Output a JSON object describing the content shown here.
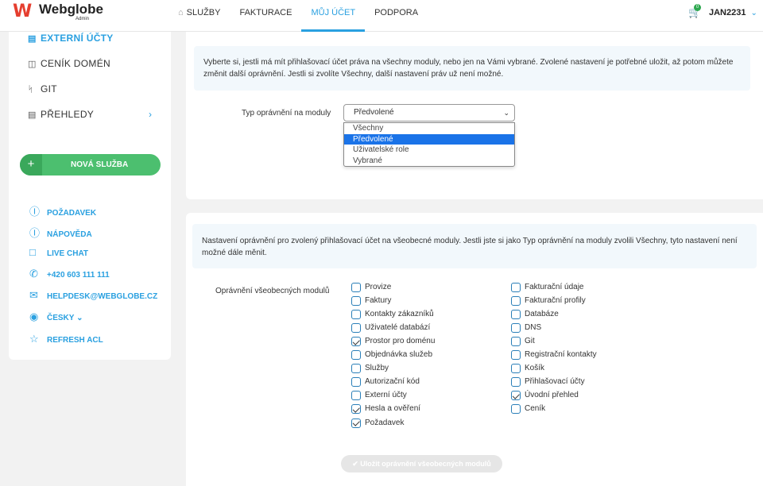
{
  "header": {
    "logo": {
      "name": "Webglobe",
      "sub": "Admin"
    },
    "nav": [
      {
        "label": "SLUŽBY",
        "icon": "home-icon"
      },
      {
        "label": "FAKTURACE"
      },
      {
        "label": "MŮJ ÚČET",
        "active": true
      },
      {
        "label": "PODPORA"
      }
    ],
    "cart_count": "0",
    "user": "JAN2231"
  },
  "sidebar": {
    "items": [
      {
        "label": "EXTERNÍ ÚČTY",
        "icon": "window-icon",
        "active": true
      },
      {
        "label": "CENÍK DOMÉN",
        "icon": "tag-icon"
      },
      {
        "label": "GIT",
        "icon": "git-branch-icon"
      },
      {
        "label": "PŘEHLEDY",
        "icon": "window-icon"
      }
    ],
    "new_service": "NOVÁ SLUŽBA",
    "contacts": [
      {
        "label": "POŽADAVEK",
        "icon": "question-circle-icon"
      },
      {
        "label": "NÁPOVĚDA",
        "icon": "info-circle-icon"
      },
      {
        "label": "LIVE CHAT",
        "icon": "chat-icon"
      },
      {
        "label": "+420 603 111 111",
        "icon": "phone-icon"
      },
      {
        "label": "HELPDESK@WEBGLOBE.CZ",
        "icon": "envelope-icon"
      },
      {
        "label": "ČESKY",
        "icon": "globe-icon"
      },
      {
        "label": "REFRESH ACL",
        "icon": "star-icon"
      }
    ]
  },
  "panel1": {
    "info": "Vyberte si, jestli má mít přihlašovací účet práva na všechny moduly, nebo jen na Vámi vybrané. Zvolené nastavení je potřebné uložit, až potom můžete změnit další oprávnění. Jestli si zvolíte Všechny, další nastavení práv už není možné.",
    "field_label": "Typ oprávnění na moduly",
    "select_value": "Předvolené",
    "options": [
      "Všechny",
      "Předvolené",
      "Uživatelské role",
      "Vybrané"
    ],
    "selected_index": 1
  },
  "panel2": {
    "info": "Nastavení oprávnění pro zvolený přihlašovací účet na všeobecné moduly. Jestli jste si jako Typ oprávnění na moduly zvolili Všechny, tyto nastavení není možné dále měnit.",
    "field_label": "Oprávnění všeobecných modulů",
    "col1": [
      {
        "label": "Provize",
        "checked": false
      },
      {
        "label": "Faktury",
        "checked": false
      },
      {
        "label": "Kontakty zákazníků",
        "checked": false
      },
      {
        "label": "Uživatelé databází",
        "checked": false
      },
      {
        "label": "Prostor pro doménu",
        "checked": true
      },
      {
        "label": "Objednávka služeb",
        "checked": false
      },
      {
        "label": "Služby",
        "checked": false
      },
      {
        "label": "Autorizační kód",
        "checked": false
      },
      {
        "label": "Externí účty",
        "checked": false
      },
      {
        "label": "Hesla a ověření",
        "checked": true
      },
      {
        "label": "Požadavek",
        "checked": true
      }
    ],
    "col2": [
      {
        "label": "Fakturační údaje",
        "checked": false
      },
      {
        "label": "Fakturační profily",
        "checked": false
      },
      {
        "label": "Databáze",
        "checked": false
      },
      {
        "label": "DNS",
        "checked": false
      },
      {
        "label": "Git",
        "checked": false
      },
      {
        "label": "Registrační kontakty",
        "checked": false
      },
      {
        "label": "Košík",
        "checked": false
      },
      {
        "label": "Přihlašovací účty",
        "checked": false
      },
      {
        "label": "Úvodní přehled",
        "checked": true
      },
      {
        "label": "Ceník",
        "checked": false
      }
    ],
    "save_button": "✔ Uložit oprávnění všeobecných modulů"
  },
  "colors": {
    "accent": "#2aa0e0",
    "green": "#4cbf6f",
    "brand_red": "#e53e2f"
  }
}
